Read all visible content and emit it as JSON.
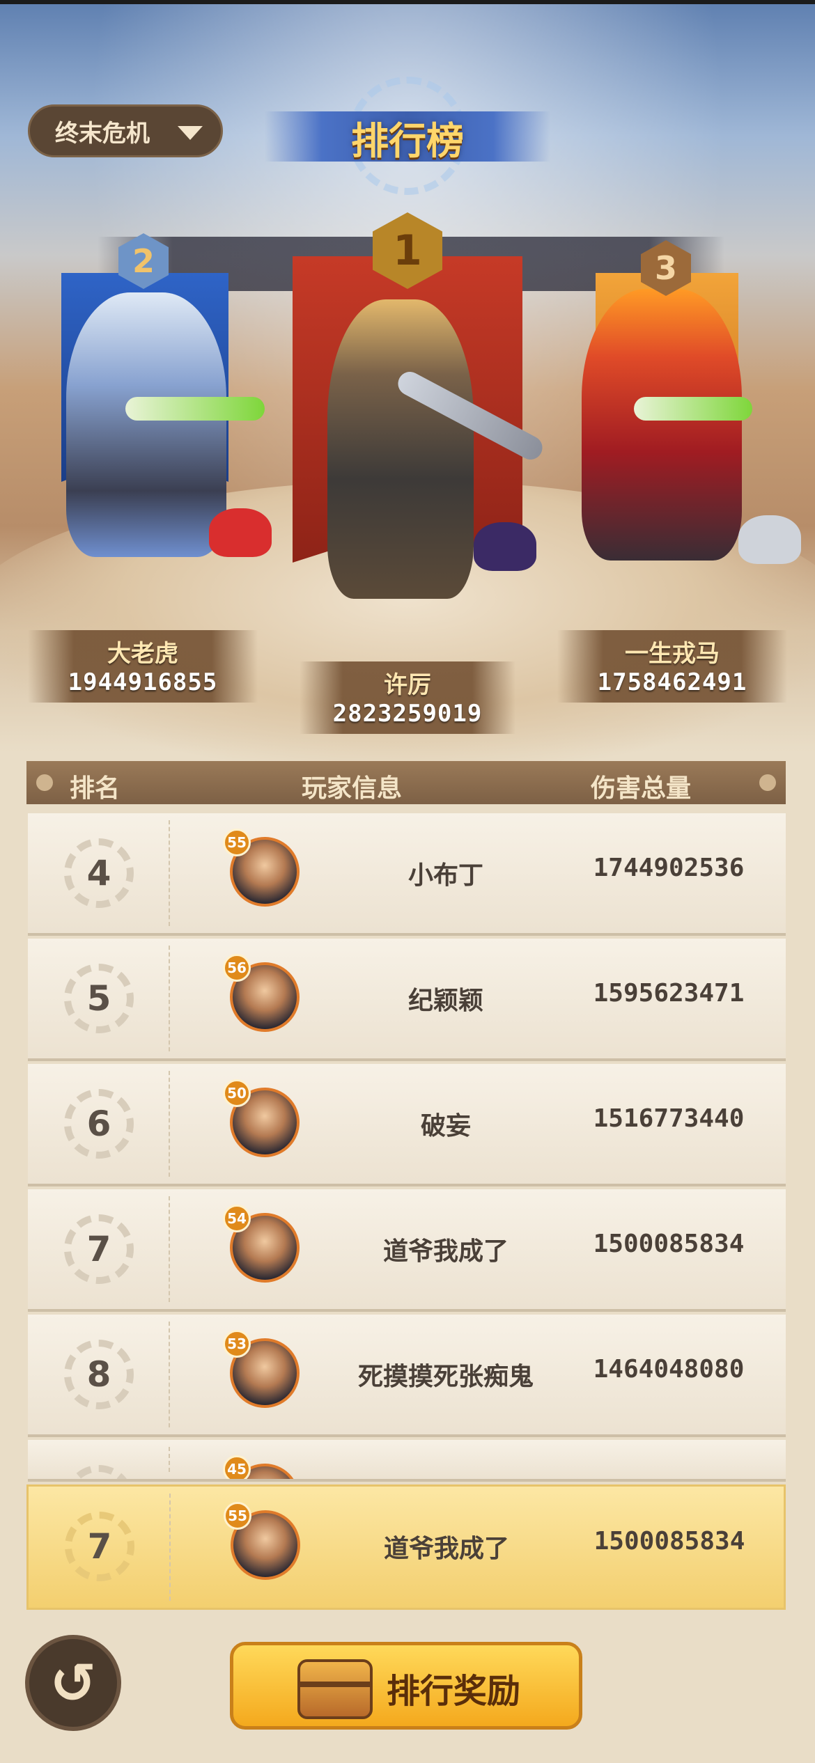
{
  "window": {
    "title": "排行榜"
  },
  "mode_select": {
    "label": "终末危机",
    "icon": "chevron-down-icon"
  },
  "podium": [
    {
      "rank": "2",
      "name": "大老虎",
      "score": "1944916855"
    },
    {
      "rank": "1",
      "name": "许厉",
      "score": "2823259019"
    },
    {
      "rank": "3",
      "name": "一生戎马",
      "score": "1758462491"
    }
  ],
  "table": {
    "headers": {
      "rank": "排名",
      "player": "玩家信息",
      "damage": "伤害总量"
    },
    "rows": [
      {
        "rank": "4",
        "level": "55",
        "name": "小布丁",
        "damage": "1744902536"
      },
      {
        "rank": "5",
        "level": "56",
        "name": "纪颖颖",
        "damage": "1595623471"
      },
      {
        "rank": "6",
        "level": "50",
        "name": "破妄",
        "damage": "1516773440"
      },
      {
        "rank": "7",
        "level": "54",
        "name": "道爷我成了",
        "damage": "1500085834"
      },
      {
        "rank": "8",
        "level": "53",
        "name": "死摸摸死张痴鬼",
        "damage": "1464048080"
      },
      {
        "rank": "",
        "level": "45",
        "name": "",
        "damage": ""
      }
    ]
  },
  "self_rank": {
    "rank": "7",
    "level": "55",
    "name": "道爷我成了",
    "damage": "1500085834"
  },
  "buttons": {
    "back_icon": "back-arrow-icon",
    "reward_label": "排行奖励"
  },
  "colors": {
    "accent_gold": "#ffd66b",
    "button_yellow": "#f4a91d",
    "header_brown": "#7d6045"
  }
}
